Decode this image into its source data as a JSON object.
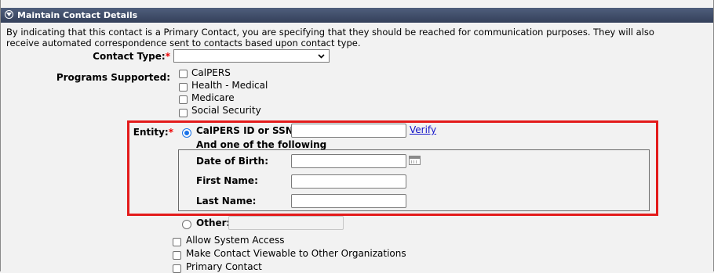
{
  "header": {
    "title": "Maintain Contact Details"
  },
  "intro_text": "By indicating that this contact is a Primary Contact, you are specifying that they should be reached for communication purposes. They will also receive automated correspondence sent to contacts based upon contact type.",
  "contact_type": {
    "label": "Contact Type:",
    "required_mark": "*",
    "value": ""
  },
  "programs": {
    "label": "Programs Supported:",
    "options": [
      "CalPERS",
      "Health - Medical",
      "Medicare",
      "Social Security"
    ]
  },
  "entity": {
    "label": "Entity:",
    "required_mark": "*",
    "calpers_label": "CalPERS ID or SSN:",
    "calpers_value": "",
    "verify_label": "Verify",
    "one_of_label": "And one of the following",
    "dob_label": "Date of Birth:",
    "dob_value": "",
    "first_name_label": "First Name:",
    "first_name_value": "",
    "last_name_label": "Last Name:",
    "last_name_value": "",
    "other_label": "Other:",
    "other_value": ""
  },
  "options": [
    "Allow System Access",
    "Make Contact Viewable to Other Organizations",
    "Primary Contact"
  ],
  "colors": {
    "header_bg": "#3f4b66",
    "required": "#e00000",
    "highlight_border": "#e31b1b",
    "link": "#1515c9"
  }
}
